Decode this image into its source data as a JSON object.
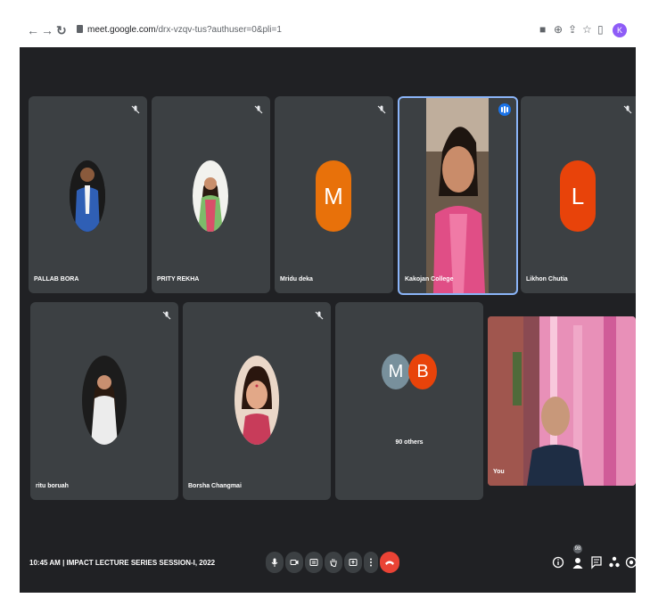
{
  "browser": {
    "url_host": "meet.google.com",
    "url_rest": "/drx-vzqv-tus?authuser=0&pli=1",
    "profile_initial": "K"
  },
  "participants": [
    {
      "name": "PALLAB BORA",
      "avatar": "photo",
      "muted": true
    },
    {
      "name": "PRITY REKHA",
      "avatar": "photo",
      "muted": true
    },
    {
      "name": "Mridu deka",
      "avatar": "letter",
      "letter": "M",
      "color": "#e8710a",
      "muted": true
    },
    {
      "name": "Kakojan College",
      "avatar": "video",
      "speaking": true
    },
    {
      "name": "Likhon Chutia",
      "avatar": "letter",
      "letter": "L",
      "color": "#e8430a",
      "muted": true
    },
    {
      "name": "ritu boruah",
      "avatar": "photo",
      "muted": true
    },
    {
      "name": "Borsha Changmai",
      "avatar": "photo",
      "muted": true
    },
    {
      "name": "You",
      "avatar": "video"
    }
  ],
  "others_tile": {
    "label": "90 others",
    "avatars": [
      {
        "letter": "M",
        "color": "#78909c"
      },
      {
        "letter": "B",
        "color": "#e8430a"
      }
    ]
  },
  "meeting": {
    "time": "10:45 AM",
    "separator": "|",
    "title": "IMPACT LECTURE SERIES SESSION-I, 2022"
  },
  "people_count": "98",
  "colors": {
    "background": "#202124",
    "tile": "#3c4043",
    "end_call": "#ea4335",
    "speaking": "#1a73e8"
  }
}
